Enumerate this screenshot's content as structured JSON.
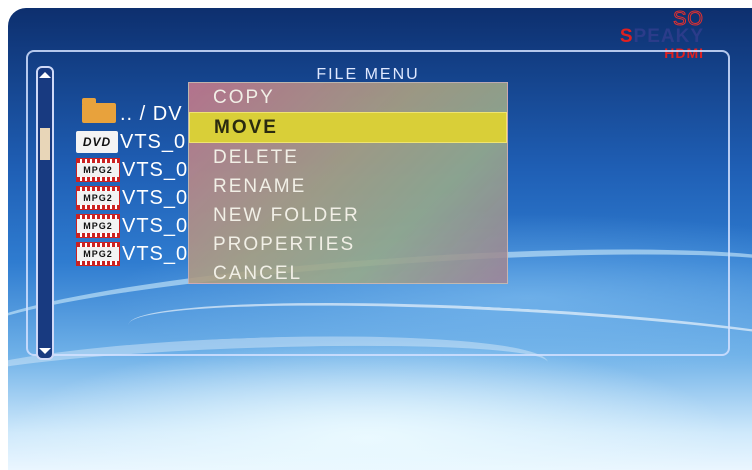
{
  "logo": {
    "top": "SO",
    "brand_s": "S",
    "brand_rest": "PEAKY",
    "sub": "HDMI"
  },
  "panel": {
    "title": "FILE MENU"
  },
  "files": [
    {
      "icon": "folder-icon",
      "label": ".. / DV"
    },
    {
      "icon": "dvd-icon",
      "badge": "DVD",
      "label": "VTS_0"
    },
    {
      "icon": "mpg2-icon",
      "badge": "MPG2",
      "label": "VTS_0"
    },
    {
      "icon": "mpg2-icon",
      "badge": "MPG2",
      "label": "VTS_0"
    },
    {
      "icon": "mpg2-icon",
      "badge": "MPG2",
      "label": "VTS_0"
    },
    {
      "icon": "mpg2-icon",
      "badge": "MPG2",
      "label": "VTS_0"
    }
  ],
  "menu": {
    "items": [
      "COPY",
      "MOVE",
      "DELETE",
      "RENAME",
      "NEW FOLDER",
      "PROPERTIES",
      "CANCEL"
    ],
    "selected": "MOVE"
  },
  "colors": {
    "highlight": "#d9cf38",
    "panel_border": "#d2e1ff"
  }
}
